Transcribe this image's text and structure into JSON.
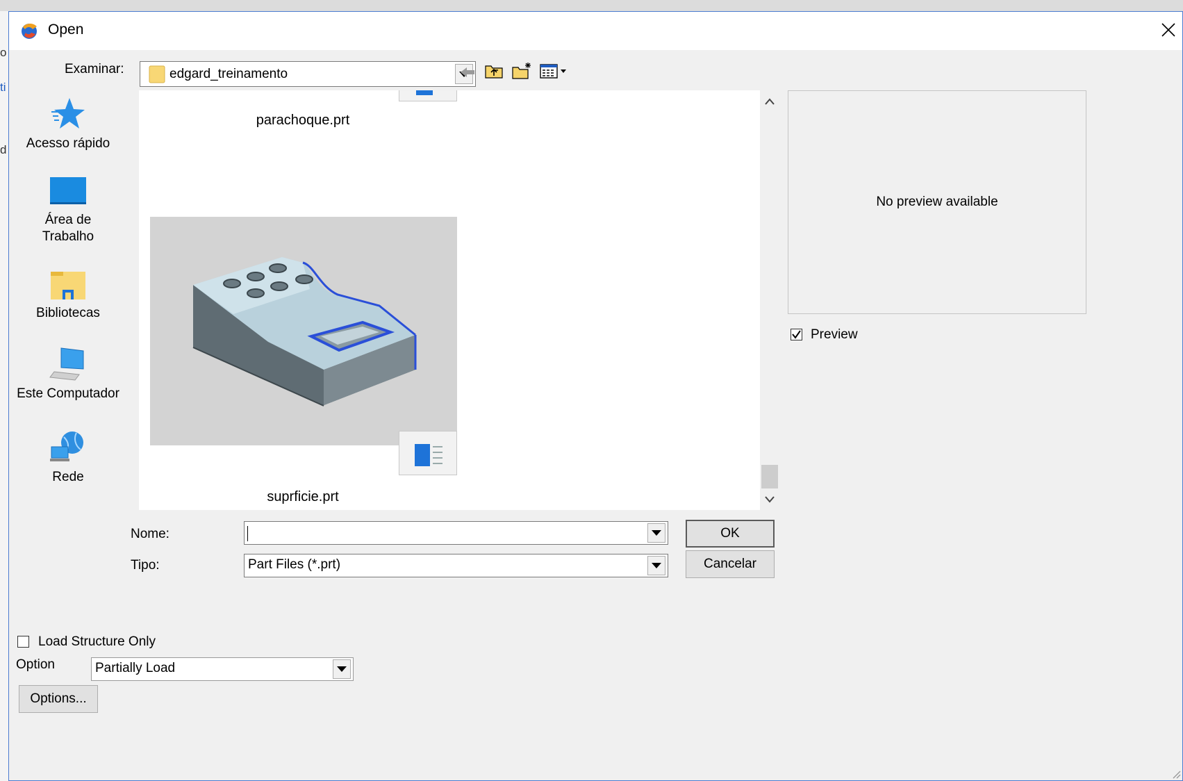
{
  "window": {
    "title": "Open",
    "close_icon": "close-icon"
  },
  "background_fragments": [
    "o",
    "ti",
    "d"
  ],
  "look_in": {
    "label": "Examinar:",
    "value": "edgard_treinamento"
  },
  "toolbar": {
    "icons": [
      "back-arrow-icon",
      "up-folder-icon",
      "new-folder-icon",
      "view-menu-icon"
    ]
  },
  "places": [
    {
      "label": "Acesso rápido",
      "icon": "star-icon"
    },
    {
      "label": "Área de Trabalho",
      "icon": "desktop-icon"
    },
    {
      "label": "Bibliotecas",
      "icon": "libraries-icon"
    },
    {
      "label": "Este Computador",
      "icon": "computer-icon"
    },
    {
      "label": "Rede",
      "icon": "network-icon"
    }
  ],
  "files": [
    {
      "name": "parachoque.prt"
    },
    {
      "name": "suprficie.prt"
    }
  ],
  "preview": {
    "message": "No preview available",
    "checkbox_label": "Preview",
    "checked": true
  },
  "name_field": {
    "label": "Nome:",
    "value": ""
  },
  "type_field": {
    "label": "Tipo:",
    "value": "Part Files (*.prt)"
  },
  "buttons": {
    "ok": "OK",
    "cancel": "Cancelar",
    "options": "Options..."
  },
  "load_structure": {
    "label": "Load Structure Only",
    "checked": false
  },
  "option": {
    "label": "Option",
    "value": "Partially Load"
  },
  "colors": {
    "accent_blue": "#1e73d8",
    "dialog_bg": "#f0f0f0"
  }
}
